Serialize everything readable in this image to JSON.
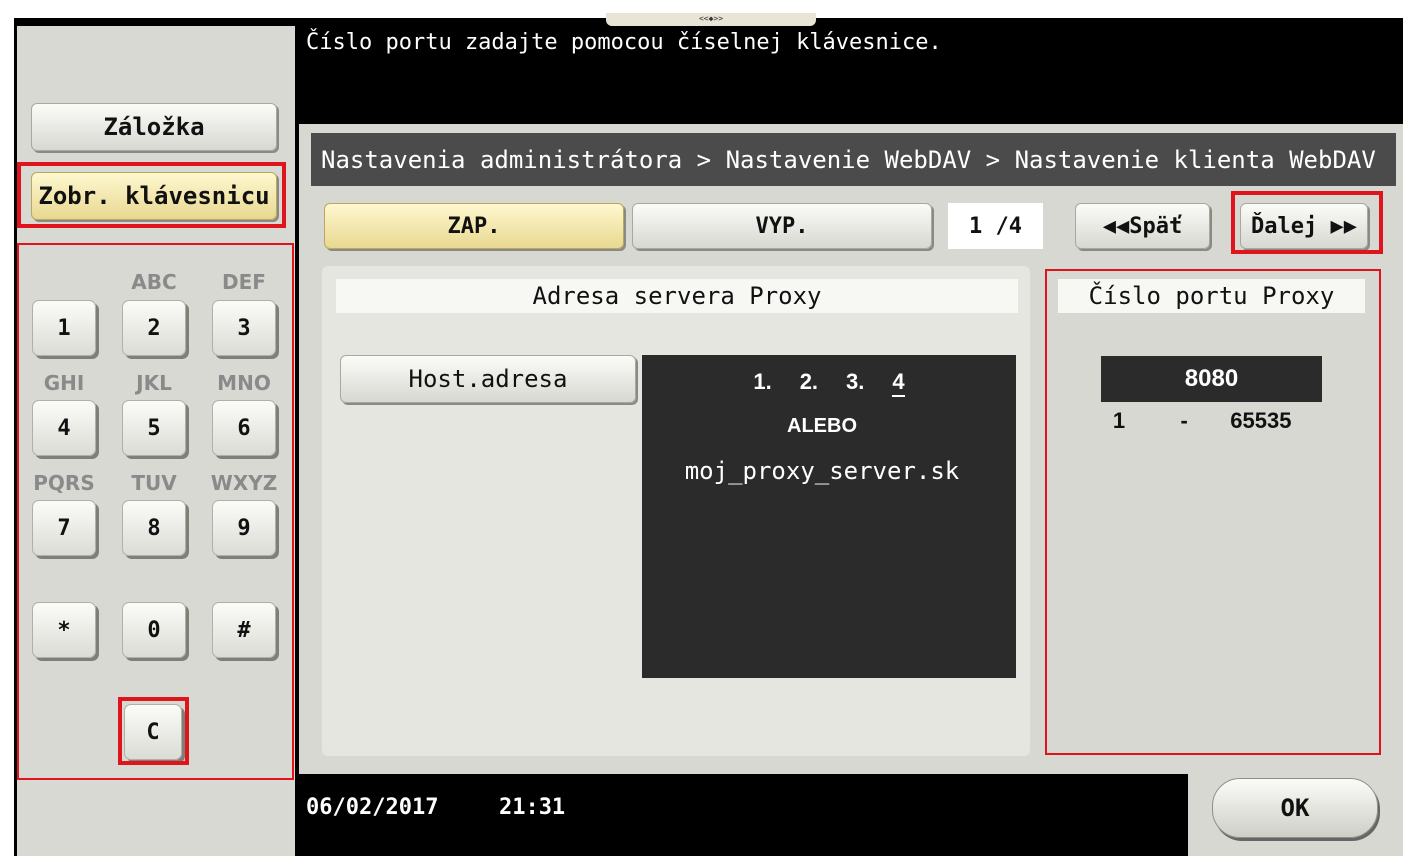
{
  "top_message": "Číslo portu zadajte pomocou číselnej klávesnice.",
  "handle_glyph": "<<◆>>",
  "left_panel": {
    "bookmark_label": "Záložka",
    "show_keypad_label": "Zobr. klávesnicu"
  },
  "keypad": {
    "letters": [
      "ABC",
      "DEF",
      "GHI",
      "JKL",
      "MNO",
      "PQRS",
      "TUV",
      "WXYZ"
    ],
    "keys": [
      "1",
      "2",
      "3",
      "4",
      "5",
      "6",
      "7",
      "8",
      "9",
      "*",
      "0",
      "#"
    ],
    "clear_label": "C"
  },
  "breadcrumb": "Nastavenia administrátora > Nastavenie WebDAV > Nastavenie klienta WebDAV",
  "toggle": {
    "on_label": "ZAP.",
    "off_label": "VYP."
  },
  "pager": {
    "text": "1 /4",
    "back_label": "◀◀Späť",
    "next_label": "Ďalej ▶▶"
  },
  "proxy_address": {
    "section_label": "Adresa servera Proxy",
    "host_button_label": "Host.adresa",
    "ip_octets": [
      "1.",
      "2.",
      "3.",
      "4"
    ],
    "or_label": "ALEBO",
    "hostname": "moj_proxy_server.sk"
  },
  "proxy_port": {
    "section_label": "Číslo portu Proxy",
    "value": "8080",
    "range_min": "1",
    "range_sep": "-",
    "range_max": "65535"
  },
  "footer": {
    "date": "06/02/2017",
    "time": "21:31",
    "ok_label": "OK"
  },
  "colors": {
    "highlight_red": "#e0141c",
    "selected_yellow": "#f0e4a0"
  }
}
